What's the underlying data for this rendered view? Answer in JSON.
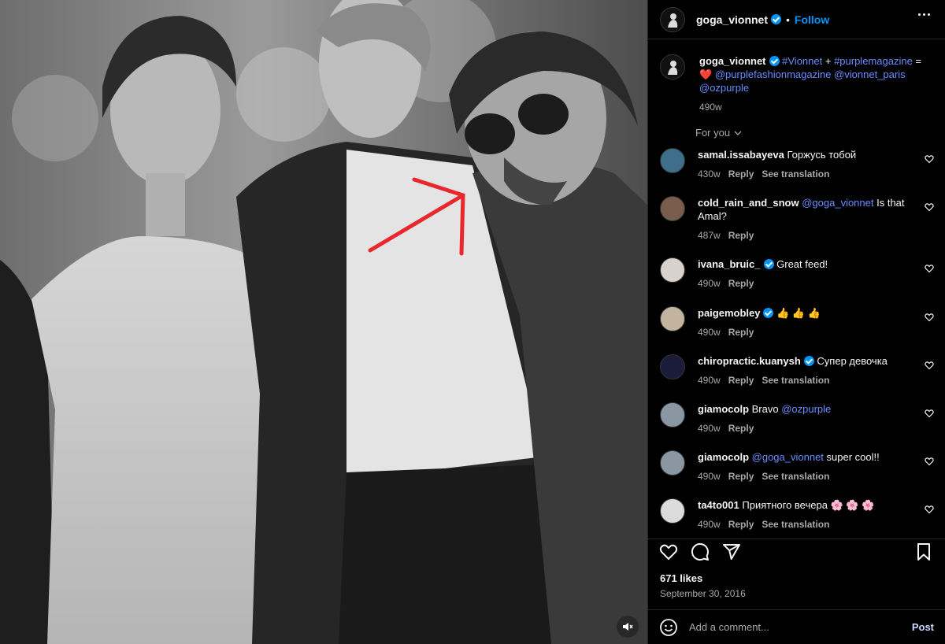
{
  "post": {
    "username": "goga_vionnet",
    "dot": "•",
    "follow_label": "Follow"
  },
  "caption": {
    "username": "goga_vionnet",
    "parts": [
      "#Vionnet",
      " + ",
      "#purplemagazine",
      " = ",
      "❤️",
      " ",
      "@purplefashionmagazine",
      " ",
      "@vionnet_paris",
      " ",
      "@ozpurple"
    ],
    "age": "490w"
  },
  "for_you_label": "For you",
  "comments": [
    {
      "username": "samal.issabayeva",
      "verified": false,
      "text": "Горжусь тобой",
      "mention": "",
      "age": "430w",
      "reply": "Reply",
      "translate": "See translation",
      "avatar_color": "#3f6e8a"
    },
    {
      "username": "cold_rain_and_snow",
      "verified": false,
      "text": " Is that Amal?",
      "mention": "@goga_vionnet",
      "age": "487w",
      "reply": "Reply",
      "translate": "",
      "avatar_color": "#7a5c4d"
    },
    {
      "username": "ivana_bruic_",
      "verified": true,
      "text": "Great feed!",
      "mention": "",
      "age": "490w",
      "reply": "Reply",
      "translate": "",
      "avatar_color": "#d9d2cc"
    },
    {
      "username": "paigemobley",
      "verified": true,
      "text": "👍 👍 👍",
      "mention": "",
      "age": "490w",
      "reply": "Reply",
      "translate": "",
      "avatar_color": "#c2b49e"
    },
    {
      "username": "chiropractic.kuanysh",
      "verified": true,
      "text": "Супер девочка",
      "mention": "",
      "age": "490w",
      "reply": "Reply",
      "translate": "See translation",
      "avatar_color": "#1b1b3a"
    },
    {
      "username": "giamocolp",
      "verified": false,
      "text": "Bravo ",
      "mention": "@ozpurple",
      "mention_after": true,
      "age": "490w",
      "reply": "Reply",
      "translate": "",
      "avatar_color": "#8a97a3"
    },
    {
      "username": "giamocolp",
      "verified": false,
      "text": " super cool!!",
      "mention": "@goga_vionnet",
      "age": "490w",
      "reply": "Reply",
      "translate": "See translation",
      "avatar_color": "#8a97a3"
    },
    {
      "username": "ta4to001",
      "verified": false,
      "text": "Приятного вечера 🌸 🌸 🌸",
      "mention": "",
      "age": "490w",
      "reply": "Reply",
      "translate": "See translation",
      "avatar_color": "#dbdbdb"
    }
  ],
  "likes": "671 likes",
  "date": "September 30, 2016",
  "add_comment": {
    "placeholder": "Add a comment...",
    "post_label": "Post"
  }
}
